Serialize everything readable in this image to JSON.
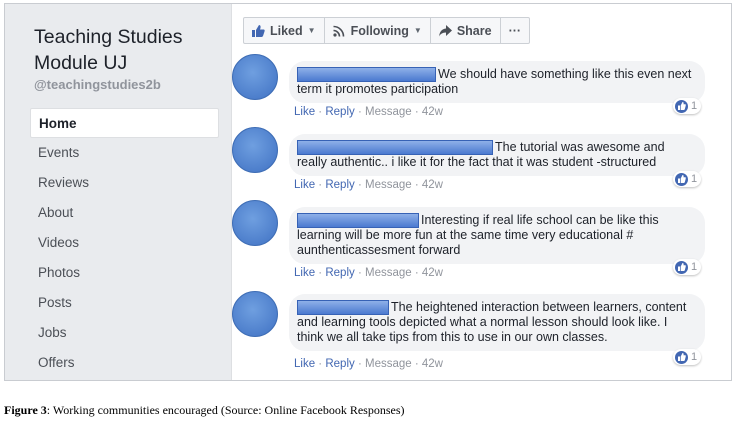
{
  "sidebar": {
    "title": "Teaching Studies Module UJ",
    "handle": "@teachingstudies2b",
    "items": [
      {
        "label": "Home",
        "active": true
      },
      {
        "label": "Events"
      },
      {
        "label": "Reviews"
      },
      {
        "label": "About"
      },
      {
        "label": "Videos"
      },
      {
        "label": "Photos"
      },
      {
        "label": "Posts"
      },
      {
        "label": "Jobs"
      },
      {
        "label": "Offers"
      }
    ]
  },
  "actions": {
    "liked": "Liked",
    "following": "Following",
    "share": "Share",
    "more": "···"
  },
  "comments": [
    {
      "text": "We should have something like this even next term it promotes participation",
      "reactions": "1"
    },
    {
      "text": "The tutorial was awesome and really authentic.. i like it for the fact that it was student -structured",
      "reactions": "1"
    },
    {
      "text": "Interesting if real life school can be like this learning will be more fun at the same time very educational # aunthenticassesment forward",
      "reactions": "1"
    },
    {
      "text": "The heightened interaction between learners, content and learning tools depicted what a normal lesson should look like. I think we all take tips from this to use in our own classes.",
      "reactions": "1"
    }
  ],
  "comment_meta": {
    "like": "Like",
    "reply": "Reply",
    "message": "Message",
    "age": "42w",
    "sep": " · "
  },
  "caption": {
    "label": "Figure 3",
    "text": ": Working communities encouraged (Source: Online Facebook Responses)"
  },
  "colors": {
    "accent": "#4267b2",
    "sidebar_bg": "#e9ebee",
    "bubble_bg": "#f2f3f5",
    "redaction": "#4b7ad0"
  }
}
